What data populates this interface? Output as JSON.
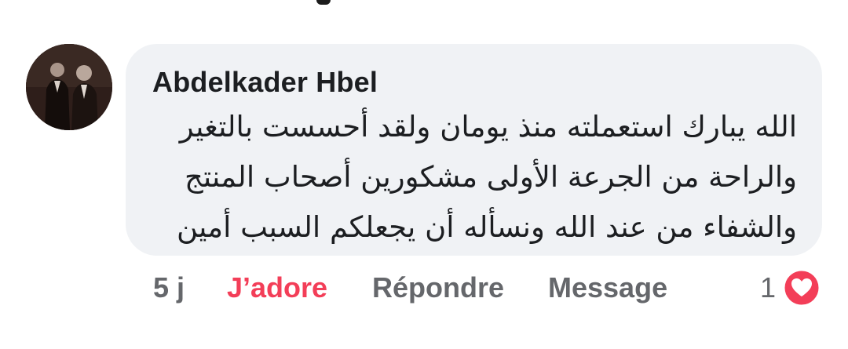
{
  "comment": {
    "author": "Abdelkader Hbel",
    "lines": [
      "الله يبارك استعملته منذ يومان ولقد أحسست بالتغير",
      "والراحة من الجرعة الأولى  مشكورين أصحاب المنتج",
      "والشفاء من عند الله ونسأله أن يجعلكم السبب أمين"
    ]
  },
  "actions": {
    "timestamp": "5 j",
    "like_label": "J’adore",
    "reply_label": "Répondre",
    "message_label": "Message"
  },
  "reactions": {
    "count": "1",
    "icon": "heart-reaction-icon",
    "color": "#f33e58"
  },
  "colors": {
    "bubble": "#f0f2f5",
    "text": "#1c1e21",
    "secondary": "#65676b",
    "liked": "#f33e58"
  }
}
